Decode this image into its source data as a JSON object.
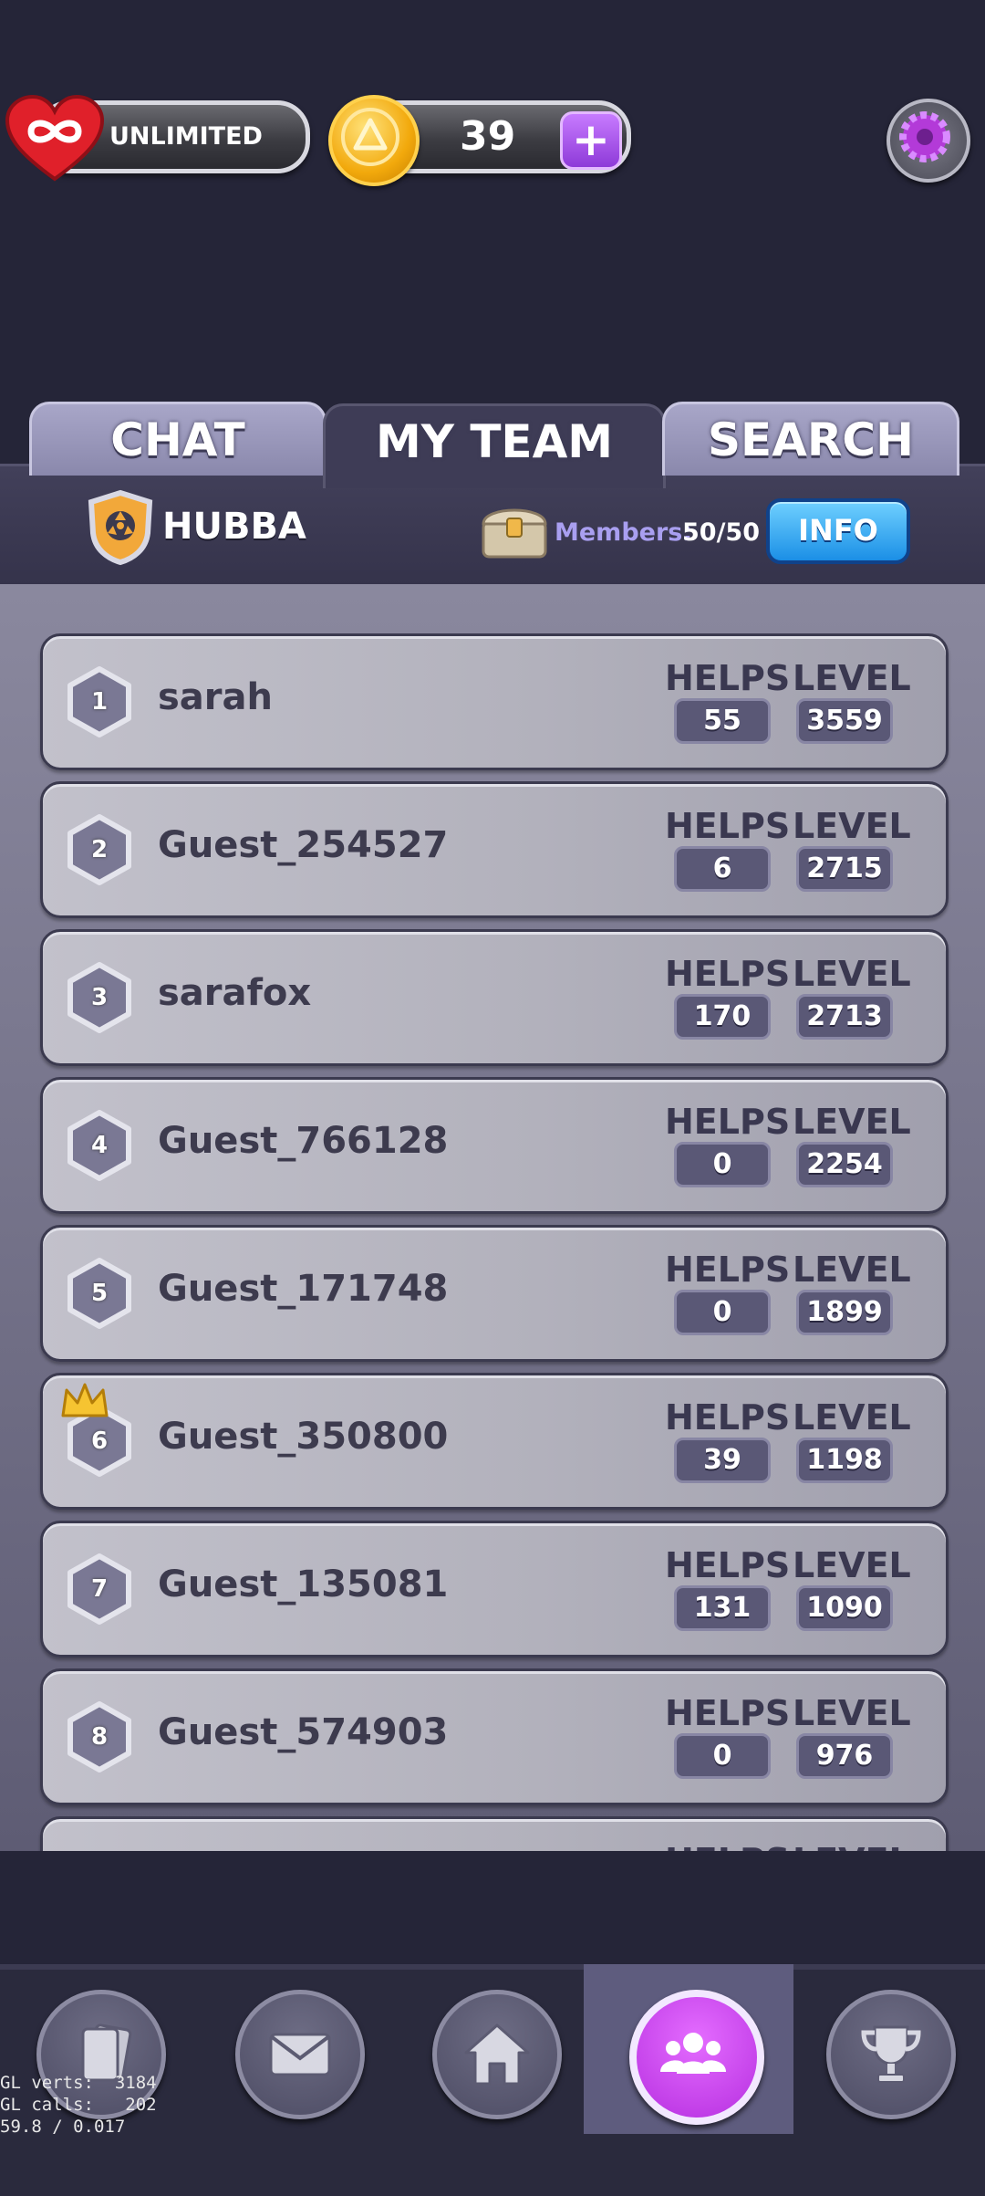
{
  "top_bar": {
    "lives_label": "UNLIMITED",
    "coins": "39",
    "plus_label": "+"
  },
  "tabs": [
    {
      "label": "CHAT",
      "active": false
    },
    {
      "label": "MY TEAM",
      "active": true
    },
    {
      "label": "SEARCH",
      "active": false
    }
  ],
  "team": {
    "name": "HUBBA",
    "members_label": "Members:",
    "members_value": "50/50",
    "info_label": "INFO"
  },
  "columns": {
    "helps": "HELPS",
    "level": "LEVEL"
  },
  "members": [
    {
      "rank": "1",
      "name": "sarah",
      "helps": "55",
      "level": "3559",
      "crown": false
    },
    {
      "rank": "2",
      "name": "Guest_254527",
      "helps": "6",
      "level": "2715",
      "crown": false
    },
    {
      "rank": "3",
      "name": "sarafox",
      "helps": "170",
      "level": "2713",
      "crown": false
    },
    {
      "rank": "4",
      "name": "Guest_766128",
      "helps": "0",
      "level": "2254",
      "crown": false
    },
    {
      "rank": "5",
      "name": "Guest_171748",
      "helps": "0",
      "level": "1899",
      "crown": false
    },
    {
      "rank": "6",
      "name": "Guest_350800",
      "helps": "39",
      "level": "1198",
      "crown": true
    },
    {
      "rank": "7",
      "name": "Guest_135081",
      "helps": "131",
      "level": "1090",
      "crown": false
    },
    {
      "rank": "8",
      "name": "Guest_574903",
      "helps": "0",
      "level": "976",
      "crown": false
    }
  ],
  "partial_row": {
    "helps": "HELPS",
    "level": "LEVEL"
  },
  "nav": [
    {
      "icon": "cards-icon",
      "active": false
    },
    {
      "icon": "mail-icon",
      "active": false
    },
    {
      "icon": "home-icon",
      "active": false
    },
    {
      "icon": "team-icon",
      "active": true
    },
    {
      "icon": "trophy-icon",
      "active": false
    }
  ],
  "debug": {
    "line1": "GL verts:  3184",
    "line2": "GL calls:   202",
    "line3": "59.8 / 0.017"
  },
  "colors": {
    "background": "#252538",
    "accent_purple": "#b62fe0",
    "info_blue": "#1b8fe6",
    "coin_gold": "#f2a90c"
  }
}
